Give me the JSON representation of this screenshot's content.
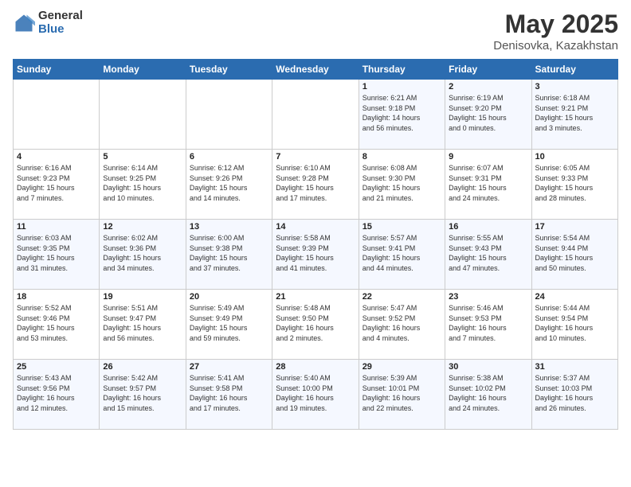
{
  "header": {
    "logo_general": "General",
    "logo_blue": "Blue",
    "title": "May 2025",
    "subtitle": "Denisovka, Kazakhstan"
  },
  "days_header": [
    "Sunday",
    "Monday",
    "Tuesday",
    "Wednesday",
    "Thursday",
    "Friday",
    "Saturday"
  ],
  "weeks": [
    [
      {
        "day": "",
        "info": ""
      },
      {
        "day": "",
        "info": ""
      },
      {
        "day": "",
        "info": ""
      },
      {
        "day": "",
        "info": ""
      },
      {
        "day": "1",
        "info": "Sunrise: 6:21 AM\nSunset: 9:18 PM\nDaylight: 14 hours\nand 56 minutes."
      },
      {
        "day": "2",
        "info": "Sunrise: 6:19 AM\nSunset: 9:20 PM\nDaylight: 15 hours\nand 0 minutes."
      },
      {
        "day": "3",
        "info": "Sunrise: 6:18 AM\nSunset: 9:21 PM\nDaylight: 15 hours\nand 3 minutes."
      }
    ],
    [
      {
        "day": "4",
        "info": "Sunrise: 6:16 AM\nSunset: 9:23 PM\nDaylight: 15 hours\nand 7 minutes."
      },
      {
        "day": "5",
        "info": "Sunrise: 6:14 AM\nSunset: 9:25 PM\nDaylight: 15 hours\nand 10 minutes."
      },
      {
        "day": "6",
        "info": "Sunrise: 6:12 AM\nSunset: 9:26 PM\nDaylight: 15 hours\nand 14 minutes."
      },
      {
        "day": "7",
        "info": "Sunrise: 6:10 AM\nSunset: 9:28 PM\nDaylight: 15 hours\nand 17 minutes."
      },
      {
        "day": "8",
        "info": "Sunrise: 6:08 AM\nSunset: 9:30 PM\nDaylight: 15 hours\nand 21 minutes."
      },
      {
        "day": "9",
        "info": "Sunrise: 6:07 AM\nSunset: 9:31 PM\nDaylight: 15 hours\nand 24 minutes."
      },
      {
        "day": "10",
        "info": "Sunrise: 6:05 AM\nSunset: 9:33 PM\nDaylight: 15 hours\nand 28 minutes."
      }
    ],
    [
      {
        "day": "11",
        "info": "Sunrise: 6:03 AM\nSunset: 9:35 PM\nDaylight: 15 hours\nand 31 minutes."
      },
      {
        "day": "12",
        "info": "Sunrise: 6:02 AM\nSunset: 9:36 PM\nDaylight: 15 hours\nand 34 minutes."
      },
      {
        "day": "13",
        "info": "Sunrise: 6:00 AM\nSunset: 9:38 PM\nDaylight: 15 hours\nand 37 minutes."
      },
      {
        "day": "14",
        "info": "Sunrise: 5:58 AM\nSunset: 9:39 PM\nDaylight: 15 hours\nand 41 minutes."
      },
      {
        "day": "15",
        "info": "Sunrise: 5:57 AM\nSunset: 9:41 PM\nDaylight: 15 hours\nand 44 minutes."
      },
      {
        "day": "16",
        "info": "Sunrise: 5:55 AM\nSunset: 9:43 PM\nDaylight: 15 hours\nand 47 minutes."
      },
      {
        "day": "17",
        "info": "Sunrise: 5:54 AM\nSunset: 9:44 PM\nDaylight: 15 hours\nand 50 minutes."
      }
    ],
    [
      {
        "day": "18",
        "info": "Sunrise: 5:52 AM\nSunset: 9:46 PM\nDaylight: 15 hours\nand 53 minutes."
      },
      {
        "day": "19",
        "info": "Sunrise: 5:51 AM\nSunset: 9:47 PM\nDaylight: 15 hours\nand 56 minutes."
      },
      {
        "day": "20",
        "info": "Sunrise: 5:49 AM\nSunset: 9:49 PM\nDaylight: 15 hours\nand 59 minutes."
      },
      {
        "day": "21",
        "info": "Sunrise: 5:48 AM\nSunset: 9:50 PM\nDaylight: 16 hours\nand 2 minutes."
      },
      {
        "day": "22",
        "info": "Sunrise: 5:47 AM\nSunset: 9:52 PM\nDaylight: 16 hours\nand 4 minutes."
      },
      {
        "day": "23",
        "info": "Sunrise: 5:46 AM\nSunset: 9:53 PM\nDaylight: 16 hours\nand 7 minutes."
      },
      {
        "day": "24",
        "info": "Sunrise: 5:44 AM\nSunset: 9:54 PM\nDaylight: 16 hours\nand 10 minutes."
      }
    ],
    [
      {
        "day": "25",
        "info": "Sunrise: 5:43 AM\nSunset: 9:56 PM\nDaylight: 16 hours\nand 12 minutes."
      },
      {
        "day": "26",
        "info": "Sunrise: 5:42 AM\nSunset: 9:57 PM\nDaylight: 16 hours\nand 15 minutes."
      },
      {
        "day": "27",
        "info": "Sunrise: 5:41 AM\nSunset: 9:58 PM\nDaylight: 16 hours\nand 17 minutes."
      },
      {
        "day": "28",
        "info": "Sunrise: 5:40 AM\nSunset: 10:00 PM\nDaylight: 16 hours\nand 19 minutes."
      },
      {
        "day": "29",
        "info": "Sunrise: 5:39 AM\nSunset: 10:01 PM\nDaylight: 16 hours\nand 22 minutes."
      },
      {
        "day": "30",
        "info": "Sunrise: 5:38 AM\nSunset: 10:02 PM\nDaylight: 16 hours\nand 24 minutes."
      },
      {
        "day": "31",
        "info": "Sunrise: 5:37 AM\nSunset: 10:03 PM\nDaylight: 16 hours\nand 26 minutes."
      }
    ]
  ]
}
